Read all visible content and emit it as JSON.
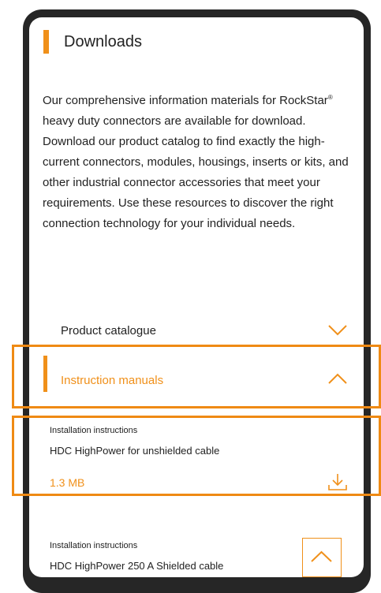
{
  "header": {
    "title": "Downloads"
  },
  "intro": {
    "text_before_reg": "Our comprehensive information materials for RockStar",
    "reg": "®",
    "text_after_reg": " heavy duty connectors are available for download. Download our product catalog to find exactly the high-current connectors, modules, housings, inserts or kits, and other industrial connector accessories that meet your requirements. Use these resources to discover the right connection technology for your individual needs."
  },
  "accordion": [
    {
      "label": "Product catalogue",
      "expanded": false
    },
    {
      "label": "Instruction manuals",
      "expanded": true
    }
  ],
  "downloads": [
    {
      "category": "Installation instructions",
      "title": "HDC HighPower for unshielded cable",
      "size": "1.3 MB"
    },
    {
      "category": "Installation instructions",
      "title": "HDC HighPower 250 A Shielded cable"
    }
  ],
  "colors": {
    "accent": "#f0901a",
    "highlight": "#ef8a14",
    "frame": "#262626"
  },
  "icons": {
    "collapsed": "chevron-down-icon",
    "expanded": "chevron-up-icon",
    "download": "download-icon",
    "scroll_top": "chevron-up-icon"
  }
}
